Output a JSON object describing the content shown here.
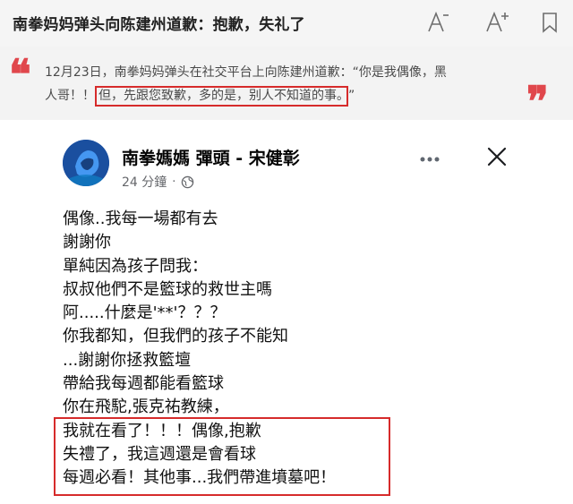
{
  "header": {
    "title": "南拳妈妈弹头向陈建州道歉：抱歉，失礼了",
    "font_decrease_icon": "font-size-decrease-icon",
    "font_increase_icon": "font-size-increase-icon",
    "bookmark_icon": "bookmark-icon"
  },
  "quote": {
    "line1": "12月23日，南拳妈妈弹头在社交平台上向陈建州道歉：“你是我偶像，黑",
    "line2_prefix": "人哥！！",
    "line2_highlight": "但，先跟您致歉，多的是，别人不知道的事。",
    "line2_suffix": "”",
    "accent_color": "#e0474c"
  },
  "post": {
    "author": "南拳媽媽 彈頭 - 宋健彰",
    "time": "24 分鐘",
    "dot": "·",
    "audience_icon": "globe-icon",
    "more_icon": "more-options-icon",
    "close_icon": "close-icon",
    "lines": [
      "偶像..我每一場都有去",
      "謝謝你",
      "單純因為孩子問我：",
      "叔叔他們不是籃球的救世主嗎",
      "阿.....什麼是'**'？？？",
      "你我都知，但我們的孩子不能知",
      "...謝謝你拯救籃壇",
      "帶給我每週都能看籃球",
      "你在飛駝,張克祐教練，",
      "我就在看了！！！偶像,抱歉",
      "失禮了，我這週還是會看球",
      "每週必看！其他事...我們帶進墳墓吧！"
    ],
    "highlight_color": "#d62b2b"
  }
}
